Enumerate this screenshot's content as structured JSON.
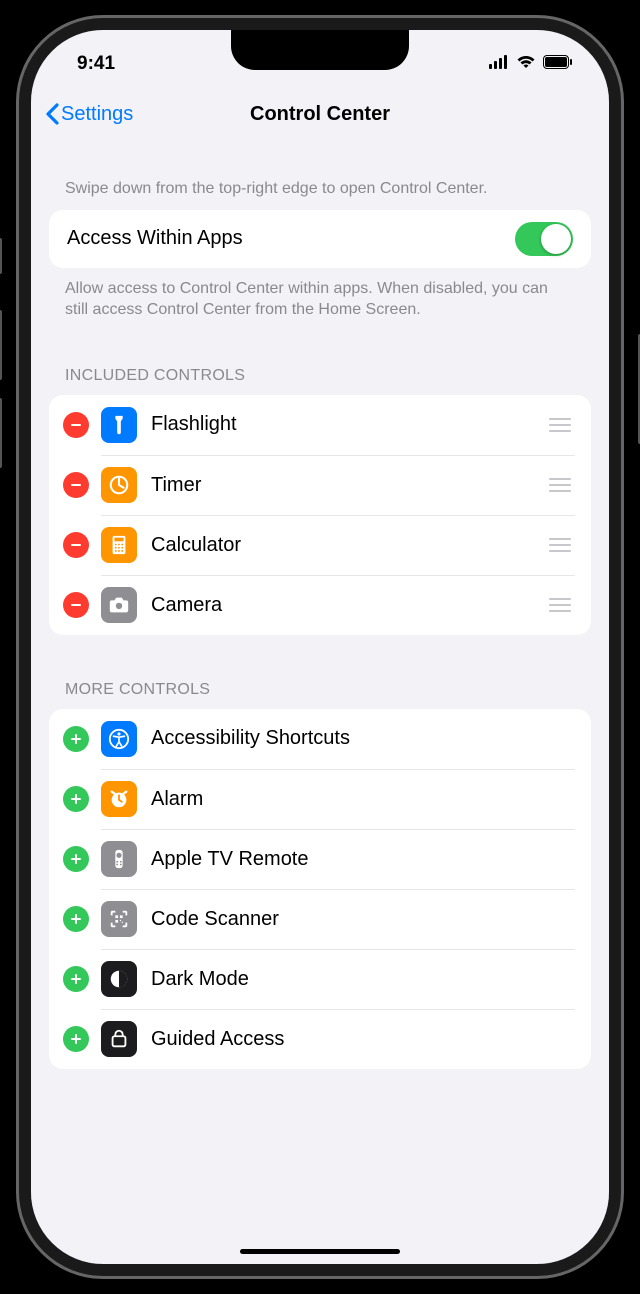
{
  "status": {
    "time": "9:41"
  },
  "nav": {
    "back": "Settings",
    "title": "Control Center"
  },
  "intro": "Swipe down from the top-right edge to open Control Center.",
  "toggle": {
    "label": "Access Within Apps",
    "on": true,
    "footer": "Allow access to Control Center within apps. When disabled, you can still access Control Center from the Home Screen."
  },
  "included": {
    "header": "Included Controls",
    "items": [
      {
        "label": "Flashlight",
        "icon": "flashlight",
        "bg": "blue"
      },
      {
        "label": "Timer",
        "icon": "timer",
        "bg": "orange"
      },
      {
        "label": "Calculator",
        "icon": "calculator",
        "bg": "orange"
      },
      {
        "label": "Camera",
        "icon": "camera",
        "bg": "gray"
      }
    ]
  },
  "more": {
    "header": "More Controls",
    "items": [
      {
        "label": "Accessibility Shortcuts",
        "icon": "accessibility",
        "bg": "blue"
      },
      {
        "label": "Alarm",
        "icon": "alarm",
        "bg": "orange"
      },
      {
        "label": "Apple TV Remote",
        "icon": "tvremote",
        "bg": "gray"
      },
      {
        "label": "Code Scanner",
        "icon": "qrcode",
        "bg": "gray"
      },
      {
        "label": "Dark Mode",
        "icon": "darkmode",
        "bg": "black"
      },
      {
        "label": "Guided Access",
        "icon": "guided",
        "bg": "black"
      }
    ]
  }
}
